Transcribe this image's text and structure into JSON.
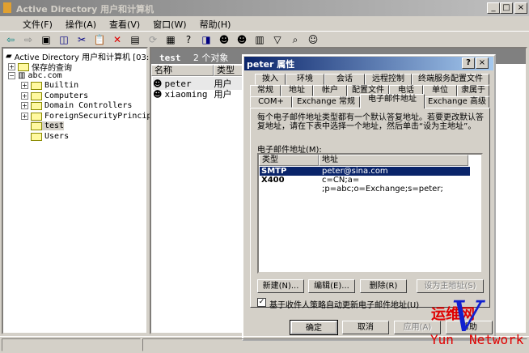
{
  "window": {
    "title": "Active Directory 用户和计算机",
    "controls": [
      "_",
      "□",
      "×"
    ]
  },
  "menu": [
    "文件(F)",
    "操作(A)",
    "查看(V)",
    "窗口(W)",
    "帮助(H)"
  ],
  "toolbar": [
    "back-icon",
    "forward-icon",
    "up-icon",
    "show-tree-icon",
    "cut-icon",
    "paste-icon",
    "delete-icon",
    "properties-icon",
    "refresh-icon",
    "export-icon",
    "help-icon",
    "console-icon",
    "new-user-icon",
    "new-group-icon",
    "new-ou-icon",
    "filter-icon",
    "find-icon",
    "add-to-group-icon"
  ],
  "tree": {
    "root": "Active Directory 用户和计算机 [03:",
    "saved": "保存的查询",
    "domain": "abc.com",
    "items": [
      "Builtin",
      "Computers",
      "Domain Controllers",
      "ForeignSecurityPrincipals",
      "test",
      "Users"
    ]
  },
  "rightpane": {
    "title": "test",
    "count": "2 个对象",
    "columns": [
      "名称",
      "类型"
    ],
    "rows": [
      {
        "name": "peter",
        "type": "用户"
      },
      {
        "name": "xiaoming",
        "type": "用户"
      }
    ]
  },
  "dialog": {
    "title": "peter 属性",
    "help": "?",
    "close": "×",
    "tabs_row1": [
      "拨入",
      "环境",
      "会话",
      "远程控制",
      "终端服务配置文件"
    ],
    "tabs_row2": [
      "常规",
      "地址",
      "帐户",
      "配置文件",
      "电话",
      "单位",
      "隶属于"
    ],
    "tabs_row3": [
      "COM+",
      "Exchange 常规",
      "电子邮件地址",
      "Exchange 高级"
    ],
    "description": "每个电子邮件地址类型都有一个默认答复地址。若要更改默认答复地址，请在下表中选择一个地址，然后单击“设为主地址”。",
    "list_label": "电子邮件地址(M):",
    "columns": [
      "类型",
      "地址"
    ],
    "addresses": [
      {
        "type": "SMTP",
        "address": "peter@sina.com",
        "selected": true
      },
      {
        "type": "X400",
        "address": "c=CN;a= ;p=abc;o=Exchange;s=peter;"
      }
    ],
    "buttons": {
      "new": "新建(N)...",
      "edit": "编辑(E)...",
      "remove": "删除(R)",
      "set_primary": "设为主地址(S)"
    },
    "checkbox": {
      "label": "基于收件人策略自动更新电子邮件地址(U)",
      "checked": true
    },
    "footer": {
      "ok": "确定",
      "cancel": "取消",
      "apply": "应用(A)",
      "help": "帮助"
    }
  },
  "watermark": {
    "cn": "运维网",
    "en_left": "Yun",
    "en_right": "Network",
    "letter": "V"
  }
}
